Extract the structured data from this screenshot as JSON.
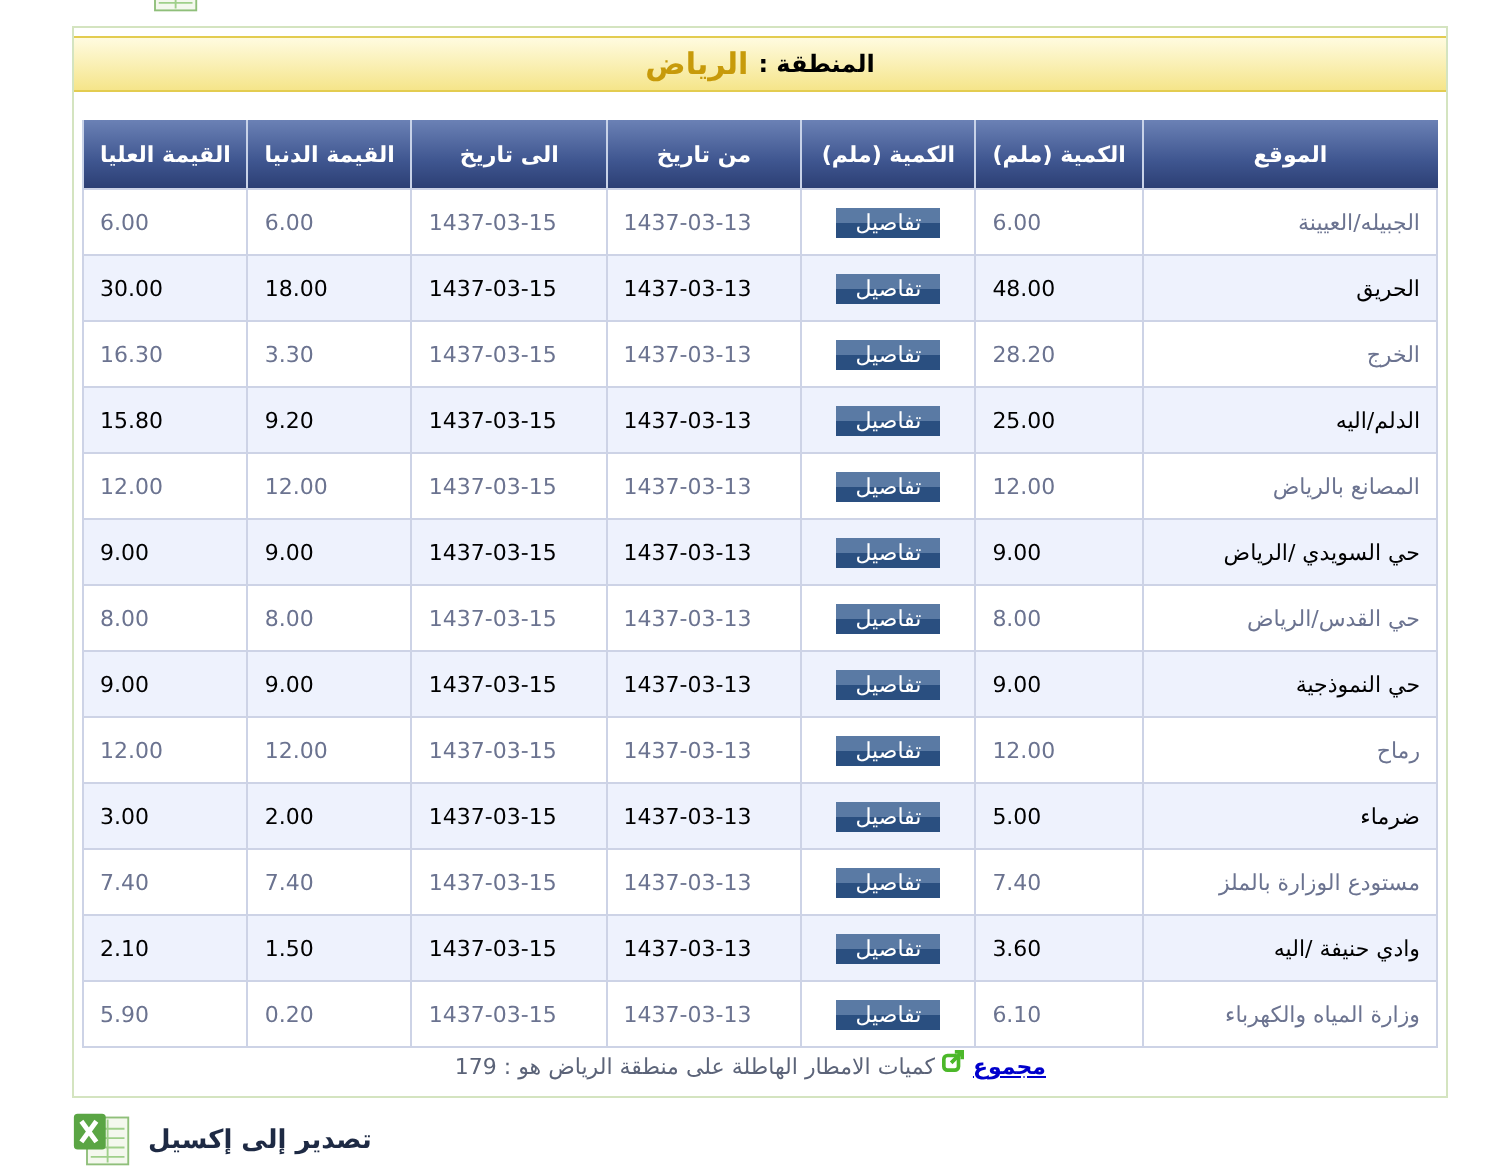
{
  "region": {
    "label": "المنطقة :",
    "value": "الرياض"
  },
  "table": {
    "columns": [
      "الموقع",
      "الكمية (ملم)",
      "الكمية (ملم)",
      "من تاريخ",
      "الى تاريخ",
      "القيمة الدنيا",
      "القيمة العليا"
    ],
    "rows": [
      {
        "site": "الجبيله/العيينة",
        "amount": "6.00",
        "button": "تفاصيل",
        "from": "1437-03-13",
        "to": "1437-03-15",
        "min": "6.00",
        "max": "6.00",
        "highlighted": false
      },
      {
        "site": "الحريق",
        "amount": "48.00",
        "button": "تفاصيل",
        "from": "1437-03-13",
        "to": "1437-03-15",
        "min": "18.00",
        "max": "30.00",
        "highlighted": true
      },
      {
        "site": "الخرج",
        "amount": "28.20",
        "button": "تفاصيل",
        "from": "1437-03-13",
        "to": "1437-03-15",
        "min": "3.30",
        "max": "16.30",
        "highlighted": false
      },
      {
        "site": "الدلم/اليه",
        "amount": "25.00",
        "button": "تفاصيل",
        "from": "1437-03-13",
        "to": "1437-03-15",
        "min": "9.20",
        "max": "15.80",
        "highlighted": true
      },
      {
        "site": "المصانع بالرياض",
        "amount": "12.00",
        "button": "تفاصيل",
        "from": "1437-03-13",
        "to": "1437-03-15",
        "min": "12.00",
        "max": "12.00",
        "highlighted": false
      },
      {
        "site": "حي السويدي /الرياض",
        "amount": "9.00",
        "button": "تفاصيل",
        "from": "1437-03-13",
        "to": "1437-03-15",
        "min": "9.00",
        "max": "9.00",
        "highlighted": true
      },
      {
        "site": "حي القدس/الرياض",
        "amount": "8.00",
        "button": "تفاصيل",
        "from": "1437-03-13",
        "to": "1437-03-15",
        "min": "8.00",
        "max": "8.00",
        "highlighted": false
      },
      {
        "site": "حي النموذجية",
        "amount": "9.00",
        "button": "تفاصيل",
        "from": "1437-03-13",
        "to": "1437-03-15",
        "min": "9.00",
        "max": "9.00",
        "highlighted": true
      },
      {
        "site": "رماح",
        "amount": "12.00",
        "button": "تفاصيل",
        "from": "1437-03-13",
        "to": "1437-03-15",
        "min": "12.00",
        "max": "12.00",
        "highlighted": false
      },
      {
        "site": "ضرماء",
        "amount": "5.00",
        "button": "تفاصيل",
        "from": "1437-03-13",
        "to": "1437-03-15",
        "min": "2.00",
        "max": "3.00",
        "highlighted": true
      },
      {
        "site": "مستودع الوزارة بالملز",
        "amount": "7.40",
        "button": "تفاصيل",
        "from": "1437-03-13",
        "to": "1437-03-15",
        "min": "7.40",
        "max": "7.40",
        "highlighted": false
      },
      {
        "site": "وادي حنيفة /اليه",
        "amount": "3.60",
        "button": "تفاصيل",
        "from": "1437-03-13",
        "to": "1437-03-15",
        "min": "1.50",
        "max": "2.10",
        "highlighted": true
      },
      {
        "site": "وزارة المياه والكهرباء",
        "amount": "6.10",
        "button": "تفاصيل",
        "from": "1437-03-13",
        "to": "1437-03-15",
        "min": "0.20",
        "max": "5.90",
        "highlighted": false
      }
    ]
  },
  "footer": {
    "link": "مجموع",
    "text": "كميات الامطار الهاطلة على منطقة الرياض هو : 179"
  },
  "export": {
    "label": "تصدير إلى إكسيل"
  }
}
